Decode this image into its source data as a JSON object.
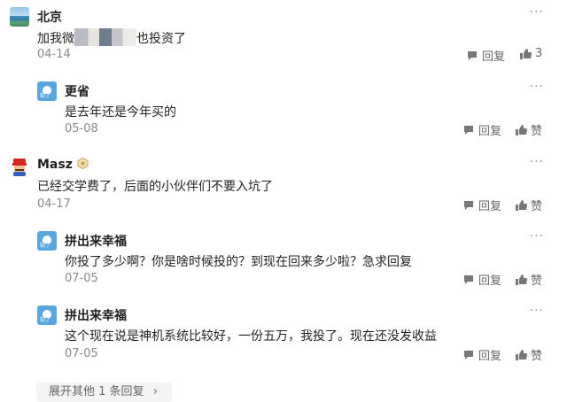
{
  "comments": [
    {
      "author": "北京",
      "text_before": "加我微",
      "text_after": "也投资了",
      "date": "04-14",
      "more": "···",
      "reply_label": "回复",
      "like_label": "3",
      "avatar_icon": "landscape-avatar"
    },
    {
      "author": "更省",
      "text": "是去年还是今年买的",
      "date": "05-08",
      "more": "···",
      "reply_label": "回复",
      "like_label": "赞",
      "avatar_icon": "blue-avatar"
    },
    {
      "author": "Masz",
      "text": "已经交学费了，后面的小伙伴们不要入坑了",
      "date": "04-17",
      "more": "···",
      "reply_label": "回复",
      "like_label": "赞",
      "avatar_icon": "mario-avatar"
    },
    {
      "author": "拼出来幸福",
      "text": "你投了多少啊？你是啥时候投的？到现在回来多少啦？急求回复",
      "date": "07-05",
      "more": "···",
      "reply_label": "回复",
      "like_label": "赞",
      "avatar_icon": "blue-avatar"
    },
    {
      "author": "拼出来幸福",
      "text": "这个现在说是神机系统比较好，一份五万，我投了。现在还没发收益",
      "date": "07-05",
      "more": "···",
      "reply_label": "回复",
      "like_label": "赞",
      "avatar_icon": "blue-avatar"
    }
  ],
  "expand": {
    "label": "展开其他 1 条回复",
    "chevron": "›"
  },
  "colors": {
    "text": "#222222",
    "meta": "#8a8a8a",
    "blue_avatar": "#5aa7e0"
  }
}
